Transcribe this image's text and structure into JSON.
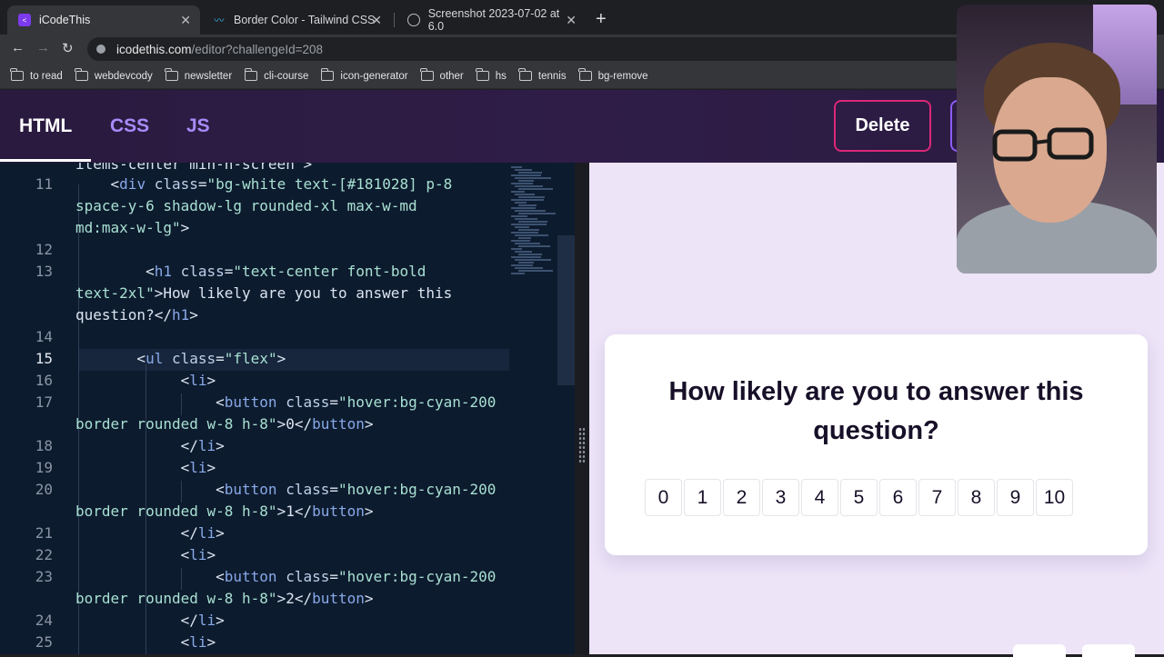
{
  "browser": {
    "tabs": [
      {
        "title": "iCodeThis",
        "active": true
      },
      {
        "title": "Border Color - Tailwind CSS",
        "active": false
      },
      {
        "title": "Screenshot 2023-07-02 at 6.0",
        "active": false
      }
    ],
    "url_host": "icodethis.com",
    "url_path": "/editor?challengeId=208",
    "bookmarks": [
      "to read",
      "webdevcody",
      "newsletter",
      "cli-course",
      "icon-generator",
      "other",
      "hs",
      "tennis",
      "bg-remove"
    ]
  },
  "app": {
    "tabs": {
      "html": "HTML",
      "css": "CSS",
      "js": "JS"
    },
    "delete_label": "Delete"
  },
  "editor": {
    "top_partial": "items-center min-h-screen\">",
    "lines": [
      {
        "num": "11",
        "html": "<span class='p'>    &lt;</span><span class='t'>div</span> <span class='a'>class</span><span class='p'>=</span><span class='s'>\"bg-white text-[#181028] p-8</span>"
      },
      {
        "num": "",
        "html": "<span class='s'>space-y-6 shadow-lg rounded-xl max-w-md</span>"
      },
      {
        "num": "",
        "html": "<span class='s'>md:max-w-lg\"</span><span class='p'>&gt;</span>"
      },
      {
        "num": "12",
        "html": ""
      },
      {
        "num": "13",
        "html": "<span class='p'>        &lt;</span><span class='t'>h1</span> <span class='a'>class</span><span class='p'>=</span><span class='s'>\"text-center font-bold</span>"
      },
      {
        "num": "",
        "html": "<span class='s'>text-2xl\"</span><span class='p'>&gt;How likely are you to answer this</span>"
      },
      {
        "num": "",
        "html": "<span class='p'>question?&lt;/</span><span class='t'>h1</span><span class='p'>&gt;</span>"
      },
      {
        "num": "14",
        "html": ""
      },
      {
        "num": "15",
        "html": "<span class='p'>       &lt;</span><span class='t'>ul</span> <span class='a'>class</span><span class='p'>=</span><span class='s'>\"flex\"</span><span class='p'>&gt;</span>"
      },
      {
        "num": "16",
        "html": "<span class='p'>            &lt;</span><span class='t'>li</span><span class='p'>&gt;</span>"
      },
      {
        "num": "17",
        "html": "<span class='p'>                &lt;</span><span class='t'>button</span> <span class='a'>class</span><span class='p'>=</span><span class='s'>\"hover:bg-cyan-200</span>"
      },
      {
        "num": "",
        "html": "<span class='s'>border rounded w-8 h-8\"</span><span class='p'>&gt;0&lt;/</span><span class='t'>button</span><span class='p'>&gt;</span>"
      },
      {
        "num": "18",
        "html": "<span class='p'>            &lt;/</span><span class='t'>li</span><span class='p'>&gt;</span>"
      },
      {
        "num": "19",
        "html": "<span class='p'>            &lt;</span><span class='t'>li</span><span class='p'>&gt;</span>"
      },
      {
        "num": "20",
        "html": "<span class='p'>                &lt;</span><span class='t'>button</span> <span class='a'>class</span><span class='p'>=</span><span class='s'>\"hover:bg-cyan-200</span>"
      },
      {
        "num": "",
        "html": "<span class='s'>border rounded w-8 h-8\"</span><span class='p'>&gt;1&lt;/</span><span class='t'>button</span><span class='p'>&gt;</span>"
      },
      {
        "num": "21",
        "html": "<span class='p'>            &lt;/</span><span class='t'>li</span><span class='p'>&gt;</span>"
      },
      {
        "num": "22",
        "html": "<span class='p'>            &lt;</span><span class='t'>li</span><span class='p'>&gt;</span>"
      },
      {
        "num": "23",
        "html": "<span class='p'>                &lt;</span><span class='t'>button</span> <span class='a'>class</span><span class='p'>=</span><span class='s'>\"hover:bg-cyan-200</span>"
      },
      {
        "num": "",
        "html": "<span class='s'>border rounded w-8 h-8\"</span><span class='p'>&gt;2&lt;/</span><span class='t'>button</span><span class='p'>&gt;</span>"
      },
      {
        "num": "24",
        "html": "<span class='p'>            &lt;/</span><span class='t'>li</span><span class='p'>&gt;</span>"
      },
      {
        "num": "25",
        "html": "<span class='p'>            &lt;</span><span class='t'>li</span><span class='p'>&gt;</span>"
      }
    ],
    "current_line": "15"
  },
  "preview": {
    "question": "How likely are you to answer this question?",
    "ratings": [
      "0",
      "1",
      "2",
      "3",
      "4",
      "5",
      "6",
      "7",
      "8",
      "9",
      "10"
    ]
  }
}
